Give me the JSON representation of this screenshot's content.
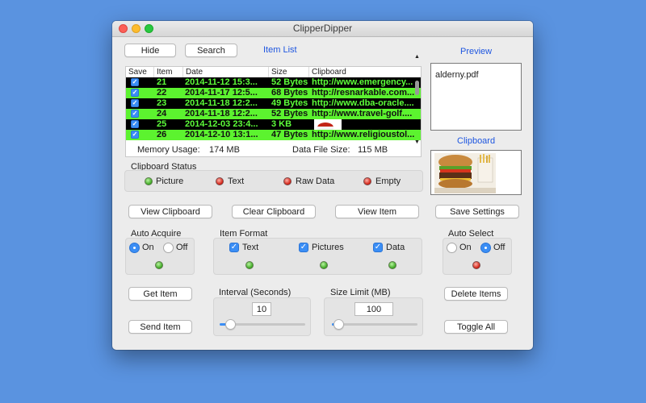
{
  "window": {
    "title": "ClipperDipper"
  },
  "toolbar": {
    "hide_label": "Hide",
    "search_label": "Search",
    "item_list_label": "Item List"
  },
  "table": {
    "columns": [
      "Save",
      "Item",
      "Date",
      "Size",
      "Clipboard"
    ],
    "rows": [
      {
        "saved": true,
        "item": "21",
        "date": "2014-11-12 15:3...",
        "size": "52 Bytes",
        "clipboard": "http://www.emergency...",
        "style": "black"
      },
      {
        "saved": true,
        "item": "22",
        "date": "2014-11-17 12:5...",
        "size": "68 Bytes",
        "clipboard": "http://resnarkable.com...",
        "style": "green"
      },
      {
        "saved": true,
        "item": "23",
        "date": "2014-11-18 12:2...",
        "size": "49 Bytes",
        "clipboard": "http://www.dba-oracle....",
        "style": "black"
      },
      {
        "saved": true,
        "item": "24",
        "date": "2014-11-18 12:2...",
        "size": "52 Bytes",
        "clipboard": "http://www.travel-golf....",
        "style": "green"
      },
      {
        "saved": true,
        "item": "25",
        "date": "2014-12-03 23:4...",
        "size": "3 KB",
        "clipboard": "",
        "style": "black",
        "image": true
      },
      {
        "saved": true,
        "item": "26",
        "date": "2014-12-10 13:1...",
        "size": "47 Bytes",
        "clipboard": "http://www.religioustol...",
        "style": "green"
      }
    ]
  },
  "stats": {
    "memory_label": "Memory Usage:",
    "memory_value": "174 MB",
    "datafile_label": "Data File Size:",
    "datafile_value": "115 MB"
  },
  "preview": {
    "title": "Preview",
    "text": "alderny.pdf",
    "clipboard_title": "Clipboard"
  },
  "clipboard_status": {
    "title": "Clipboard Status",
    "items": [
      {
        "label": "Picture",
        "state": "green"
      },
      {
        "label": "Text",
        "state": "red"
      },
      {
        "label": "Raw Data",
        "state": "red"
      },
      {
        "label": "Empty",
        "state": "red"
      }
    ]
  },
  "actions": {
    "view_clipboard": "View Clipboard",
    "clear_clipboard": "Clear Clipboard",
    "view_item": "View Item",
    "save_settings": "Save Settings",
    "get_item": "Get Item",
    "send_item": "Send Item",
    "delete_items": "Delete Items",
    "toggle_all": "Toggle All"
  },
  "auto_acquire": {
    "title": "Auto Acquire",
    "on_label": "On",
    "off_label": "Off",
    "selected": "On",
    "led": "green"
  },
  "item_format": {
    "title": "Item Format",
    "options": [
      {
        "label": "Text",
        "checked": true,
        "led": "green"
      },
      {
        "label": "Pictures",
        "checked": true,
        "led": "green"
      },
      {
        "label": "Data",
        "checked": true,
        "led": "green"
      }
    ]
  },
  "auto_select": {
    "title": "Auto Select",
    "on_label": "On",
    "off_label": "Off",
    "selected": "Off",
    "led": "red"
  },
  "interval": {
    "title": "Interval (Seconds)",
    "value": "10",
    "fraction": 0.08
  },
  "size_limit": {
    "title": "Size Limit (MB)",
    "value": "100",
    "fraction": 0.02
  },
  "colors": {
    "accent": "#3b8ef5",
    "link": "#1e56e0",
    "row_black": "#000000",
    "row_green": "#5cf32f",
    "row_text_green": "#5dff3a"
  }
}
